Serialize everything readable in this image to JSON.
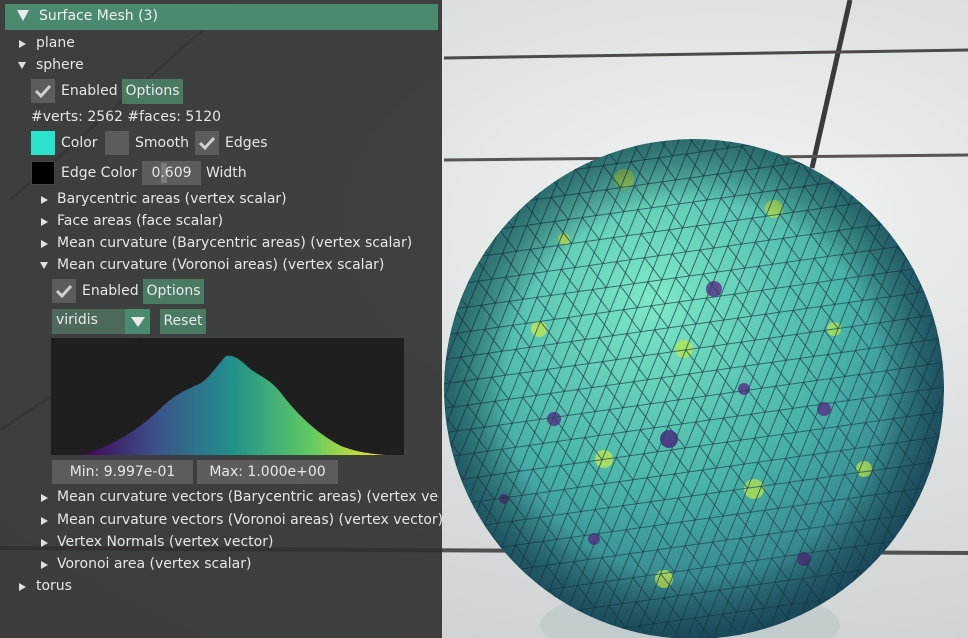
{
  "colors": {
    "panel_header": "#4a8a6e",
    "button": "#4a7a62",
    "mesh_color": "#2ae3cc",
    "edge_color": "#000000"
  },
  "panel": {
    "title": "Surface Mesh (3)",
    "meshes": [
      {
        "name": "plane",
        "expanded": false
      },
      {
        "name": "sphere",
        "expanded": true
      },
      {
        "name": "torus",
        "expanded": false
      }
    ],
    "sphere": {
      "enabled_label": "Enabled",
      "enabled": true,
      "options_label": "Options",
      "stats": "#verts: 2562  #faces: 5120",
      "color_label": "Color",
      "smooth_label": "Smooth",
      "smooth": false,
      "edges_label": "Edges",
      "edges": true,
      "edge_color_label": "Edge Color",
      "edge_width_value": "0.609",
      "width_label": "Width",
      "quantities": [
        "Barycentric areas (vertex scalar)",
        "Face areas (face scalar)",
        "Mean curvature (Barycentric areas) (vertex scalar)",
        "Mean curvature (Voronoi areas) (vertex scalar)",
        "Mean curvature vectors (Barycentric areas) (vertex vector)",
        "Mean curvature vectors (Voronoi areas) (vertex vector)",
        "Vertex Normals (vertex vector)",
        "Voronoi area (vertex scalar)"
      ],
      "active_quantity": {
        "enabled_label": "Enabled",
        "enabled": true,
        "options_label": "Options",
        "colormap": "viridis",
        "reset_label": "Reset",
        "min_label": "Min: 9.997e-01",
        "max_label": "Max: 1.000e+00"
      }
    }
  }
}
